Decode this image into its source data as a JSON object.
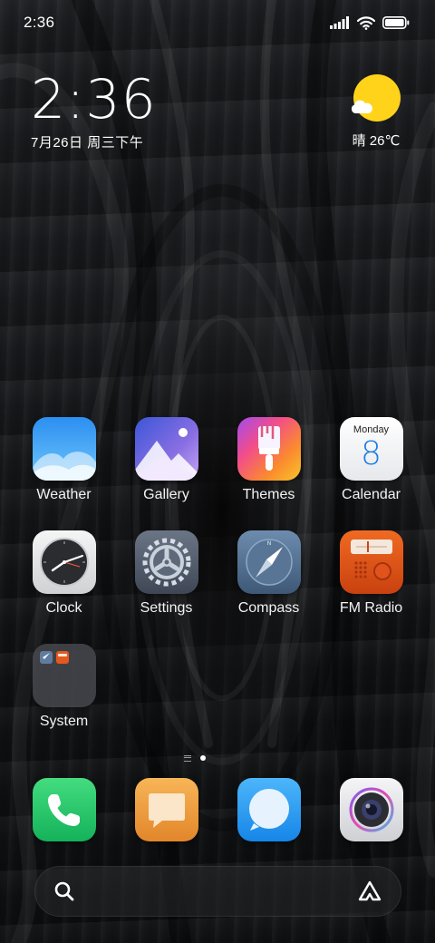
{
  "status_bar": {
    "time": "2:36",
    "icons": [
      "signal-icon",
      "wifi-icon",
      "battery-icon"
    ]
  },
  "clock_widget": {
    "time": "2:36",
    "date": "7月26日 周三下午"
  },
  "weather_widget": {
    "condition_icon": "sun-cloud-icon",
    "text": "晴 26℃"
  },
  "apps": [
    {
      "label": "Weather",
      "icon": "weather-icon"
    },
    {
      "label": "Gallery",
      "icon": "gallery-icon"
    },
    {
      "label": "Themes",
      "icon": "themes-icon"
    },
    {
      "label": "Calendar",
      "icon": "calendar-icon",
      "day_name": "Monday",
      "day_number": "8"
    },
    {
      "label": "Clock",
      "icon": "clock-icon"
    },
    {
      "label": "Settings",
      "icon": "settings-icon"
    },
    {
      "label": "Compass",
      "icon": "compass-icon"
    },
    {
      "label": "FM Radio",
      "icon": "radio-icon"
    },
    {
      "label": "System",
      "icon": "folder-icon"
    }
  ],
  "page_indicator": {
    "pages": 1,
    "current": 1
  },
  "dock": [
    {
      "icon": "phone-icon"
    },
    {
      "icon": "messages-icon"
    },
    {
      "icon": "browser-icon"
    },
    {
      "icon": "camera-icon"
    }
  ],
  "search_bar": {
    "left_icon": "search-icon",
    "right_icon": "app-vault-icon"
  },
  "colors": {
    "sun": "#ffd31a",
    "weather_blue": "#2f9cf0",
    "phone_green": "#2ecb6a",
    "messages_orange": "#f2a13b",
    "browser_blue": "#2a9cf3",
    "radio_orange": "#e2531b"
  }
}
